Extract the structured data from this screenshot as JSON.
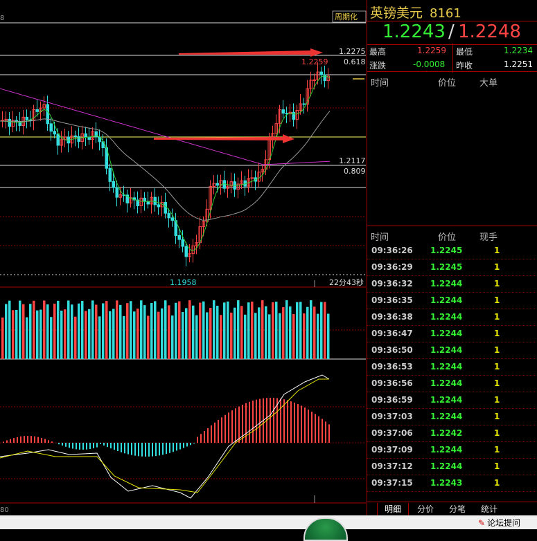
{
  "instrument": {
    "name": "英镑美元",
    "code": "8161"
  },
  "quote": {
    "bid": "1.2243",
    "sep": "/",
    "ask": "1.2248"
  },
  "stats": {
    "high_label": "最高",
    "high_value": "1.2259",
    "low_label": "最低",
    "low_value": "1.2234",
    "change_label": "涨跌",
    "change_value": "-0.0008",
    "prev_close_label": "昨收",
    "prev_close_value": "1.2251"
  },
  "big_orders": {
    "col_time": "时间",
    "col_price": "价位",
    "col_size": "大单"
  },
  "ticks": {
    "col_time": "时间",
    "col_price": "价位",
    "col_vol": "现手",
    "rows": [
      {
        "time": "09:36:26",
        "price": "1.2245",
        "vol": "1"
      },
      {
        "time": "09:36:29",
        "price": "1.2245",
        "vol": "1"
      },
      {
        "time": "09:36:32",
        "price": "1.2244",
        "vol": "1"
      },
      {
        "time": "09:36:35",
        "price": "1.2244",
        "vol": "1"
      },
      {
        "time": "09:36:38",
        "price": "1.2244",
        "vol": "1"
      },
      {
        "time": "09:36:47",
        "price": "1.2244",
        "vol": "1"
      },
      {
        "time": "09:36:50",
        "price": "1.2244",
        "vol": "1"
      },
      {
        "time": "09:36:53",
        "price": "1.2244",
        "vol": "1"
      },
      {
        "time": "09:36:56",
        "price": "1.2244",
        "vol": "1"
      },
      {
        "time": "09:36:59",
        "price": "1.2244",
        "vol": "1"
      },
      {
        "time": "09:37:03",
        "price": "1.2244",
        "vol": "1"
      },
      {
        "time": "09:37:06",
        "price": "1.2242",
        "vol": "1"
      },
      {
        "time": "09:37:09",
        "price": "1.2244",
        "vol": "1"
      },
      {
        "time": "09:37:12",
        "price": "1.2244",
        "vol": "1"
      },
      {
        "time": "09:37:15",
        "price": "1.2243",
        "vol": "1"
      }
    ]
  },
  "tabs": [
    "明细",
    "分价",
    "分笔",
    "统计"
  ],
  "chart": {
    "period_button": "周期化",
    "level_top": "1.2275",
    "fib_top": "0.618",
    "high_marker": "1.2259",
    "level_mid": "1.2117",
    "fib_mid": "0.809",
    "low_marker": "1.1958",
    "countdown": "22分43秒",
    "left_edge_top": "8",
    "left_edge_bottom": "80"
  },
  "colors": {
    "up": "#ff4444",
    "down": "#33dddd",
    "ma_fast": "#33cc33",
    "ma_slow": "#cc33cc",
    "ma_gray": "#999999",
    "arrow": "#ee3333"
  },
  "bottom": {
    "forum_label": "论坛提问"
  }
}
